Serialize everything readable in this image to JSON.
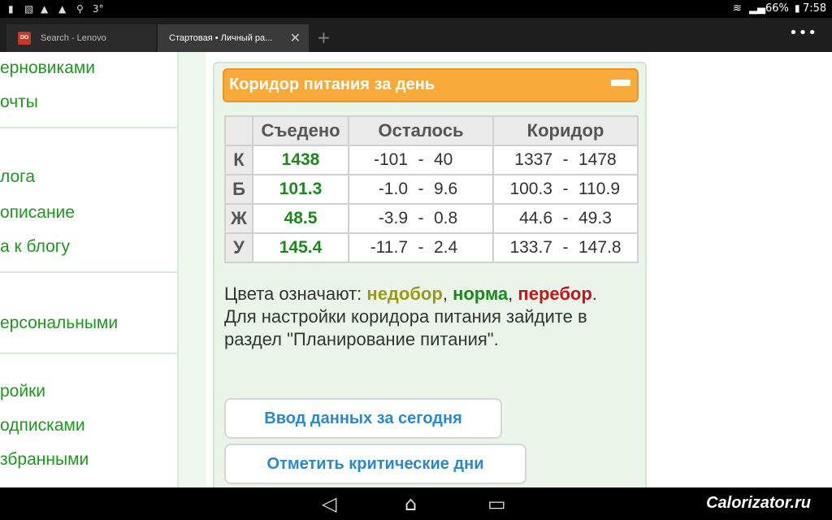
{
  "status_bar": {
    "left_icons": [
      "sim-icon",
      "image-icon",
      "warning-icon",
      "warning-icon",
      "search-icon",
      "temperature-icon"
    ],
    "temperature": "3°",
    "battery": "66%",
    "time": "7:58"
  },
  "browser": {
    "tabs": [
      {
        "title": "Search - Lenovo",
        "favicon": "DO",
        "active": false
      },
      {
        "title": "Стартовая • Личный ра...",
        "active": true
      }
    ],
    "new_tab_glyph": "+",
    "menu_glyph": "•••"
  },
  "sidebar": {
    "items": [
      {
        "label": "ерновиками"
      },
      {
        "label": "очты"
      },
      {
        "label": "лога"
      },
      {
        "label": "описание"
      },
      {
        "label": "а к блогу"
      },
      {
        "label": "ерсональными"
      },
      {
        "label": "ройки"
      },
      {
        "label": "одписками"
      },
      {
        "label": "збранными"
      }
    ]
  },
  "widget": {
    "title": "Коридор питания за день",
    "collapse_glyph": "—",
    "table": {
      "headers": [
        "",
        "Съедено",
        "Осталось",
        "Коридор"
      ],
      "rows": [
        {
          "label": "К",
          "eaten": "1438",
          "left_min": "-101",
          "left_max": "40",
          "corr_min": "1337",
          "corr_max": "1478"
        },
        {
          "label": "Б",
          "eaten": "101.3",
          "left_min": "-1.0",
          "left_max": "9.6",
          "corr_min": "100.3",
          "corr_max": "110.9"
        },
        {
          "label": "Ж",
          "eaten": "48.5",
          "left_min": "-3.9",
          "left_max": "0.8",
          "corr_min": "44.6",
          "corr_max": "49.3"
        },
        {
          "label": "У",
          "eaten": "145.4",
          "left_min": "-11.7",
          "left_max": "2.4",
          "corr_min": "133.7",
          "corr_max": "147.8"
        }
      ],
      "dash": "-"
    },
    "legend": {
      "prefix": "Цвета означают:",
      "under": "недобор",
      "norm": "норма",
      "over": "перебор",
      "comma": ",",
      "period": ".",
      "hint": "Для настройки коридора питания зайдите в раздел \"Планирование питания\"."
    },
    "buttons": {
      "enter_data": "Ввод данных за сегодня",
      "critical_days": "Отметить критические дни"
    },
    "colors": {
      "under": "#9a9a1a",
      "norm": "#1a8a1a",
      "over": "#c01818",
      "header": "#f7a93a",
      "link": "#2a8ac8"
    }
  },
  "nav_bar": {
    "back_glyph": "◁",
    "home_glyph": "⌂",
    "recents_glyph": "▭",
    "watermark": "Calorizator.ru"
  }
}
